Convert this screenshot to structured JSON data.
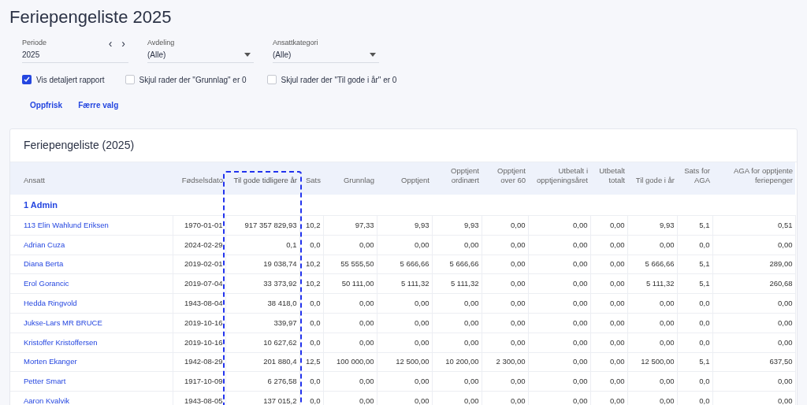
{
  "title": "Feriepengeliste 2025",
  "filters": [
    {
      "kind": "period",
      "label": "Periode",
      "value": "2025",
      "prev": "‹",
      "next": "›"
    },
    {
      "kind": "select",
      "label": "Avdeling",
      "value": "(Alle)"
    },
    {
      "kind": "select",
      "label": "Ansattkategori",
      "value": "(Alle)"
    }
  ],
  "options": [
    {
      "label": "Vis detaljert rapport",
      "checked": true
    },
    {
      "label": "Skjul rader der \"Grunnlag\" er 0",
      "checked": false
    },
    {
      "label": "Skjul rader der \"Til gode i år\" er 0",
      "checked": false
    }
  ],
  "actions": [
    "Oppfrisk",
    "Færre valg"
  ],
  "report": {
    "title": "Feriepengeliste (2025)",
    "columns": [
      {
        "label": "Ansatt",
        "highlighted": false
      },
      {
        "label": "Fødselsdato",
        "highlighted": false
      },
      {
        "label": "Til gode tidligere år",
        "highlighted": true
      },
      {
        "label": "Sats",
        "highlighted": false
      },
      {
        "label": "Grunnlag",
        "highlighted": false
      },
      {
        "label": "Opptjent",
        "highlighted": false
      },
      {
        "label": "Opptjent ordinært",
        "highlighted": false
      },
      {
        "label": "Opptjent over 60",
        "highlighted": false
      },
      {
        "label": "Utbetalt i opptjeningsåret",
        "highlighted": false
      },
      {
        "label": "Utbetalt totalt",
        "highlighted": false
      },
      {
        "label": "Til gode i år",
        "highlighted": false
      },
      {
        "label": "Sats for AGA",
        "highlighted": false
      },
      {
        "label": "AGA for opptjente feriepenger",
        "highlighted": false
      }
    ],
    "group": "1 Admin",
    "rows": [
      [
        "113 Elin Wahlund Eriksen",
        "1970-01-01",
        "917 357 829,93",
        "10,2",
        "97,33",
        "9,93",
        "9,93",
        "0,00",
        "0,00",
        "0,00",
        "9,93",
        "5,1",
        "0,51"
      ],
      [
        "Adrian Cuza",
        "2024-02-29",
        "0,1",
        "0,0",
        "0,00",
        "0,00",
        "0,00",
        "0,00",
        "0,00",
        "0,00",
        "0,00",
        "0,0",
        "0,00"
      ],
      [
        "Diana Berta",
        "2019-02-01",
        "19 038,74",
        "10,2",
        "55 555,50",
        "5 666,66",
        "5 666,66",
        "0,00",
        "0,00",
        "0,00",
        "5 666,66",
        "5,1",
        "289,00"
      ],
      [
        "Erol Gorancic",
        "2019-07-04",
        "33 373,92",
        "10,2",
        "50 111,00",
        "5 111,32",
        "5 111,32",
        "0,00",
        "0,00",
        "0,00",
        "5 111,32",
        "5,1",
        "260,68"
      ],
      [
        "Hedda Ringvold",
        "1943-08-04",
        "38 418,0",
        "0,0",
        "0,00",
        "0,00",
        "0,00",
        "0,00",
        "0,00",
        "0,00",
        "0,00",
        "0,0",
        "0,00"
      ],
      [
        "Jukse-Lars MR BRUCE",
        "2019-10-16",
        "339,97",
        "0,0",
        "0,00",
        "0,00",
        "0,00",
        "0,00",
        "0,00",
        "0,00",
        "0,00",
        "0,0",
        "0,00"
      ],
      [
        "Kristoffer Kristoffersen",
        "2019-10-16",
        "10 627,62",
        "0,0",
        "0,00",
        "0,00",
        "0,00",
        "0,00",
        "0,00",
        "0,00",
        "0,00",
        "0,0",
        "0,00"
      ],
      [
        "Morten Ekanger",
        "1942-08-29",
        "201 880,4",
        "12,5",
        "100 000,00",
        "12 500,00",
        "10 200,00",
        "2 300,00",
        "0,00",
        "0,00",
        "12 500,00",
        "5,1",
        "637,50"
      ],
      [
        "Petter Smart",
        "1917-10-09",
        "6 276,58",
        "0,0",
        "0,00",
        "0,00",
        "0,00",
        "0,00",
        "0,00",
        "0,00",
        "0,00",
        "0,0",
        "0,00"
      ],
      [
        "Aaron Kvalvik",
        "1943-08-05",
        "137 015,2",
        "0,0",
        "0,00",
        "0,00",
        "0,00",
        "0,00",
        "0,00",
        "0,00",
        "0,00",
        "0,0",
        "0,00"
      ]
    ]
  }
}
